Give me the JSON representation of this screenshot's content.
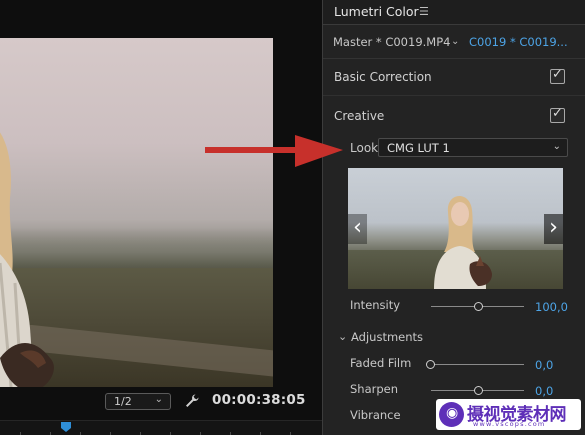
{
  "monitor": {
    "zoom_level": "1/2",
    "timecode": "00:00:38:05"
  },
  "panel": {
    "title": "Lumetri Color",
    "menu_icon": "menu-icon",
    "master_label": "Master * C0019.MP4",
    "clip_label": "C0019 * C0019...",
    "sections": [
      {
        "label": "Basic Correction",
        "checked": true
      },
      {
        "label": "Creative",
        "checked": true
      }
    ],
    "look": {
      "label": "Look",
      "value": "CMG LUT 1"
    },
    "intensity": {
      "label": "Intensity",
      "value": "100,0",
      "level": 100
    },
    "adjustments": {
      "label": "Adjustments",
      "rows": [
        {
          "label": "Faded Film",
          "value": "0,0"
        },
        {
          "label": "Sharpen",
          "value": "0,0"
        },
        {
          "label": "Vibrance",
          "value": ""
        }
      ]
    }
  },
  "watermark": {
    "text": "摄视觉素材网",
    "url": "www.vscops.com"
  },
  "colors": {
    "accent_blue": "#4da4e6",
    "arrow_red": "#c7302b",
    "watermark_purple": "#5e2fb8"
  }
}
